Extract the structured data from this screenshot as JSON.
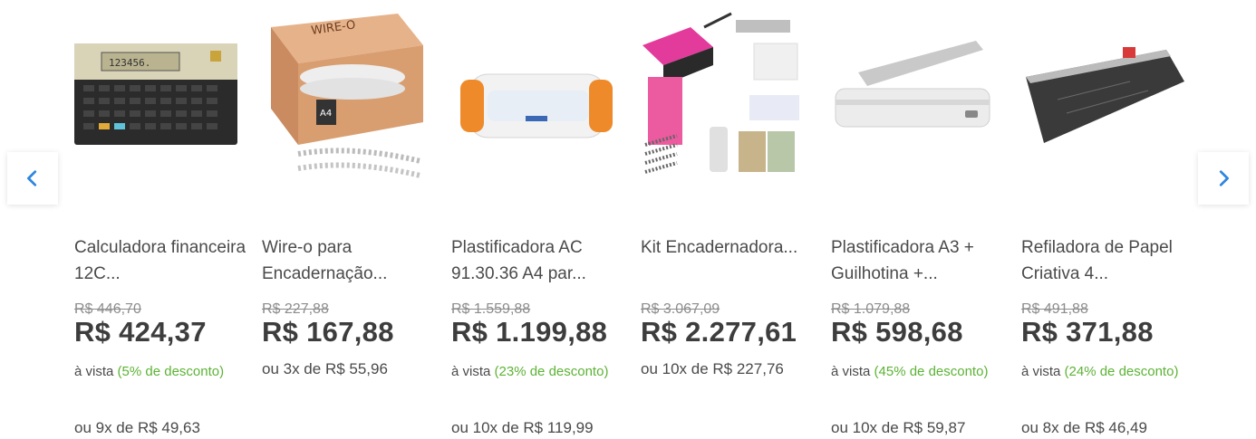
{
  "carousel": {
    "prev_icon": "chevron-left-icon",
    "next_icon": "chevron-right-icon",
    "accent_color": "#2e86de",
    "discount_color": "#5cb335"
  },
  "products": [
    {
      "title": "Calculadora financeira 12C...",
      "old_price": "R$ 446,70",
      "price": "R$ 424,37",
      "cash_prefix": "à vista ",
      "discount": "(5% de desconto)",
      "installments": "ou 9x de R$ 49,63"
    },
    {
      "title": "Wire-o para Encadernação...",
      "old_price": "R$ 227,88",
      "price": "R$ 167,88",
      "installments": "ou 3x de R$ 55,96"
    },
    {
      "title": "Plastificadora AC 91.30.36 A4 par...",
      "old_price": "R$ 1.559,88",
      "price": "R$ 1.199,88",
      "cash_prefix": "à vista ",
      "discount": "(23% de desconto)",
      "installments": "ou 10x de R$ 119,99"
    },
    {
      "title": "Kit Encadernadora...",
      "old_price": "R$ 3.067,09",
      "price": "R$ 2.277,61",
      "installments": "ou 10x de R$ 227,76"
    },
    {
      "title": "Plastificadora A3 + Guilhotina +...",
      "old_price": "R$ 1.079,88",
      "price": "R$ 598,68",
      "cash_prefix": "à vista ",
      "discount": "(45% de desconto)",
      "installments": "ou 10x de R$ 59,87"
    },
    {
      "title": "Refiladora de Papel Criativa 4...",
      "old_price": "R$ 491,88",
      "price": "R$ 371,88",
      "cash_prefix": "à vista ",
      "discount": "(24% de desconto)",
      "installments": "ou 8x de R$ 46,49"
    }
  ]
}
